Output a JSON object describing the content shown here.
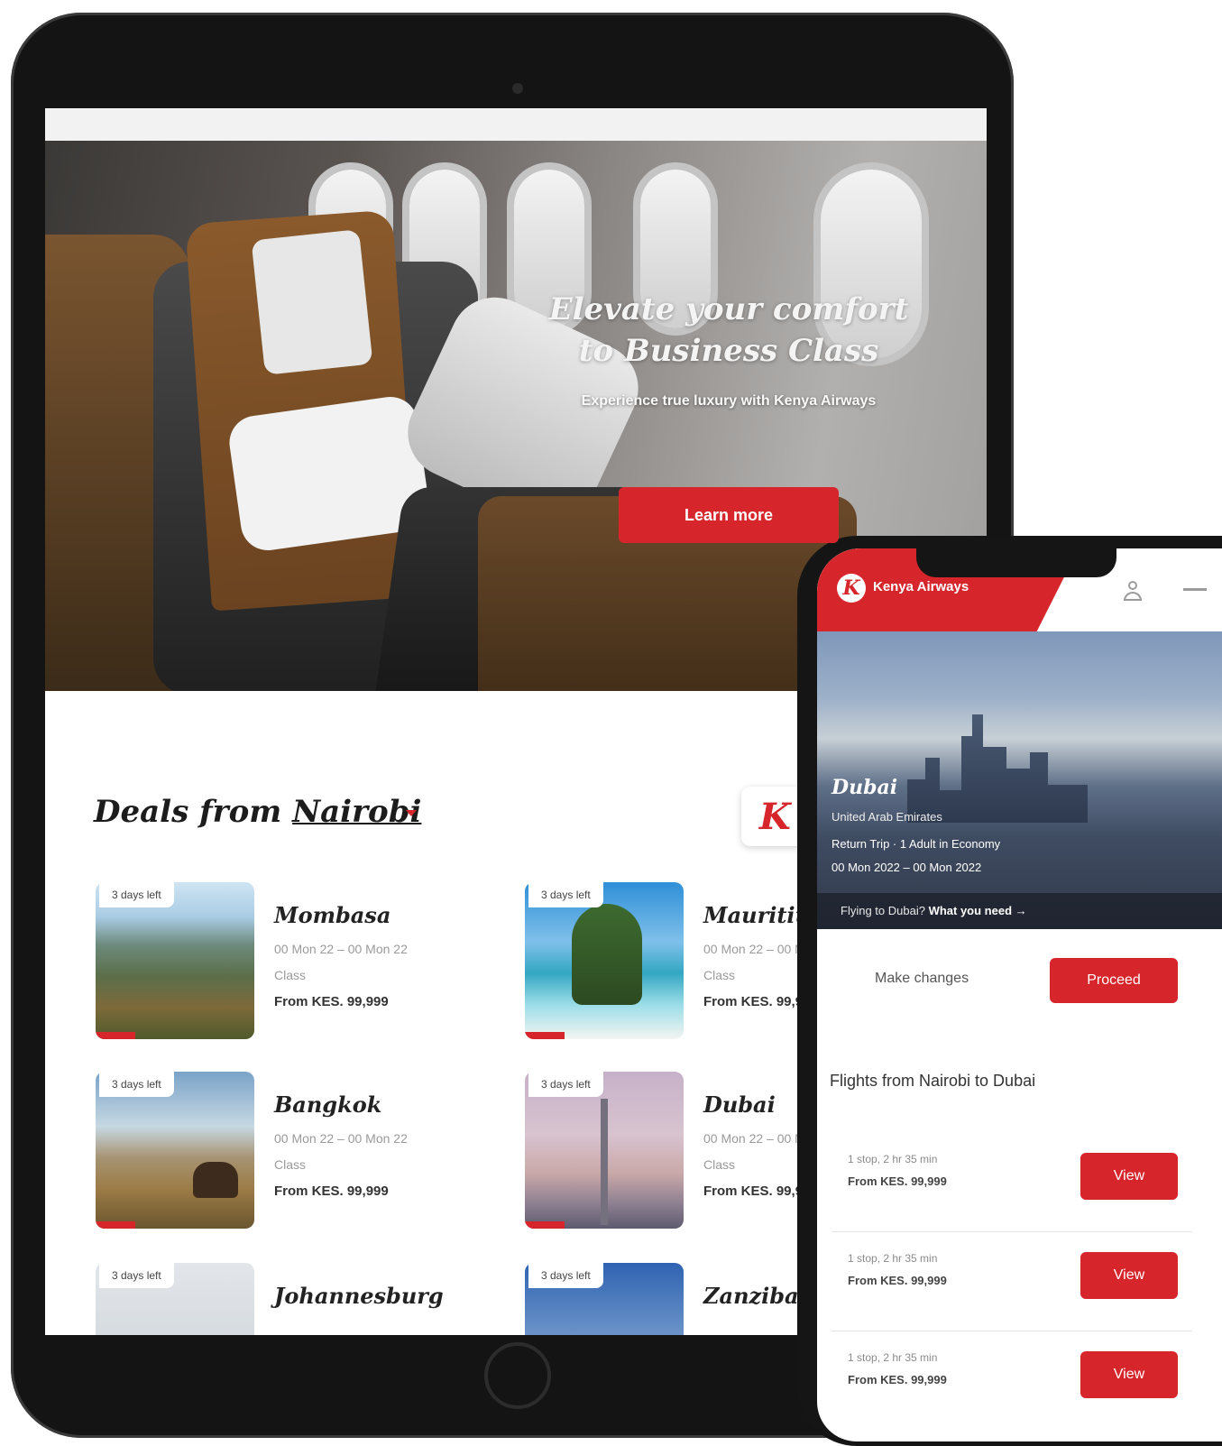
{
  "tablet": {
    "hero": {
      "title": "Elevate your comfort to Business Class",
      "subtitle": "Experience true luxury with Kenya Airways",
      "button_label": "Learn more"
    },
    "deals": {
      "heading_prefix": "Deals from ",
      "origin": "Nairobi",
      "logo_letter": "K",
      "items": [
        {
          "badge": "3 days left",
          "city": "Mombasa",
          "dates": "00 Mon 22 – 00 Mon 22",
          "class": "Class",
          "price": "From KES. 99,999"
        },
        {
          "badge": "3 days left",
          "city": "Mauritius",
          "dates": "00 Mon 22 – 00 Mon 22",
          "class": "Class",
          "price": "From KES. 99,999"
        },
        {
          "badge": "3 days left",
          "city": "Bangkok",
          "dates": "00 Mon 22 – 00 Mon 22",
          "class": "Class",
          "price": "From KES. 99,999"
        },
        {
          "badge": "3 days left",
          "city": "Dubai",
          "dates": "00 Mon 22 – 00 Mon 22",
          "class": "Class",
          "price": "From KES. 99,999"
        },
        {
          "badge": "3 days left",
          "city": "Johannesburg"
        },
        {
          "badge": "3 days left",
          "city": "Zanzibar"
        }
      ]
    }
  },
  "phone": {
    "brand": "Kenya Airways",
    "logo_letter": "K",
    "destination": {
      "city": "Dubai",
      "country": "United Arab Emirates",
      "trip": "Return Trip · 1 Adult in Economy",
      "dates": "00 Mon 2022 – 00 Mon 2022"
    },
    "info_prefix": "Flying to Dubai? ",
    "info_link": "What you need →",
    "make_changes": "Make changes",
    "proceed": "Proceed",
    "flights_title": "Flights from Nairobi to Dubai",
    "flights": [
      {
        "info": "1 stop, 2 hr 35 min",
        "price": "From KES. 99,999",
        "button": "View"
      },
      {
        "info": "1 stop, 2 hr 35 min",
        "price": "From KES. 99,999",
        "button": "View"
      },
      {
        "info": "1 stop, 2 hr 35 min",
        "price": "From KES. 99,999",
        "button": "View"
      }
    ]
  },
  "colors": {
    "accent": "#d6262c",
    "text": "#222222",
    "muted": "#9a9a9a"
  }
}
